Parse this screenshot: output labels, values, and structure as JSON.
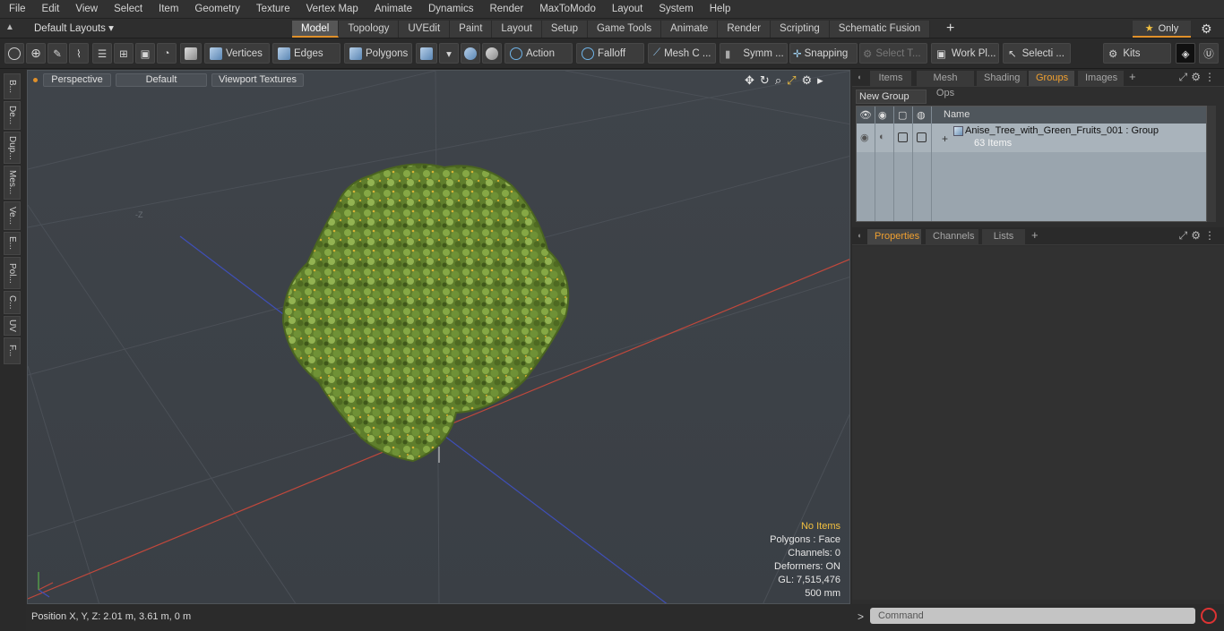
{
  "menu": [
    "File",
    "Edit",
    "View",
    "Select",
    "Item",
    "Geometry",
    "Texture",
    "Vertex Map",
    "Animate",
    "Dynamics",
    "Render",
    "MaxToModo",
    "Layout",
    "System",
    "Help"
  ],
  "layout_selector": "Default Layouts ▾",
  "layout_tabs": [
    "Model",
    "Topology",
    "UVEdit",
    "Paint",
    "Layout",
    "Setup",
    "Game Tools",
    "Animate",
    "Render",
    "Scripting",
    "Schematic Fusion"
  ],
  "active_layout_tab": "Model",
  "only_label": "Only",
  "toolbar": {
    "vertices": "Vertices",
    "edges": "Edges",
    "polygons": "Polygons",
    "action": "Action",
    "falloff": "Falloff",
    "mesh": "Mesh C ...",
    "symm": "Symm ...",
    "snapping": "Snapping",
    "select_t": "Select T...",
    "work_pl": "Work Pl...",
    "selecti": "Selecti ...",
    "kits": "Kits"
  },
  "left_tabs": [
    "B...",
    "De...",
    "Dup...",
    "Mes...",
    "Ve...",
    "E...",
    "Pol...",
    "C...",
    "UV",
    "F..."
  ],
  "viewport": {
    "view": "Perspective",
    "shading": "Default",
    "textures": "Viewport Textures",
    "axis_hint": "-Z",
    "stats": {
      "selection": "No Items",
      "polygons": "Polygons : Face",
      "channels": "Channels: 0",
      "deformers": "Deformers: ON",
      "gl": "GL: 7,515,476",
      "scale": "500 mm"
    }
  },
  "status": "Position X, Y, Z:   2.01 m, 3.61 m, 0 m",
  "top_panel": {
    "tabs": [
      "Items",
      "Mesh Ops",
      "Shading",
      "Groups",
      "Images"
    ],
    "active": "Groups",
    "new_group": "New Group",
    "col_name": "Name",
    "group_name": "Anise_Tree_with_Green_Fruits_001 : Group",
    "group_count": "63 Items"
  },
  "bottom_panel": {
    "tabs": [
      "Properties",
      "Channels",
      "Lists"
    ],
    "active": "Properties"
  },
  "command_placeholder": "Command",
  "colors": {
    "accent": "#e0902a",
    "x_axis": "#c0483c",
    "z_axis": "#3f4fb8",
    "foliage": "#6f8e35"
  }
}
